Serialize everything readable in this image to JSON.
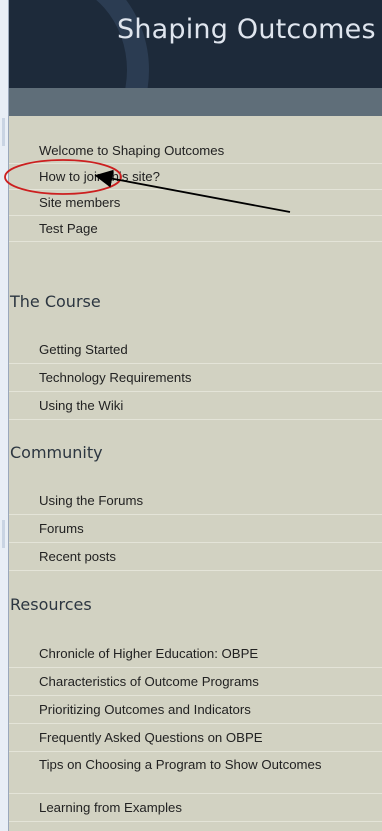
{
  "site": {
    "title": "Shaping Outcomes"
  },
  "nav": {
    "top_items": [
      {
        "label": "Welcome to Shaping Outcomes"
      },
      {
        "label": "How to join this site?"
      },
      {
        "label": "Site members"
      },
      {
        "label": "Test Page"
      }
    ],
    "sections": [
      {
        "heading": "The Course",
        "items": [
          {
            "label": "Getting Started"
          },
          {
            "label": "Technology Requirements"
          },
          {
            "label": "Using the Wiki"
          }
        ]
      },
      {
        "heading": "Community",
        "items": [
          {
            "label": "Using the Forums"
          },
          {
            "label": "Forums"
          },
          {
            "label": "Recent posts"
          }
        ]
      },
      {
        "heading": "Resources",
        "items": [
          {
            "label": "Chronicle of Higher Education: OBPE"
          },
          {
            "label": "Characteristics of Outcome Programs"
          },
          {
            "label": "Prioritizing Outcomes and Indicators"
          },
          {
            "label": "Frequently Asked Questions on OBPE"
          },
          {
            "label": "Tips on Choosing a Program to Show Outcomes"
          },
          {
            "label": "Learning from Examples"
          }
        ]
      }
    ]
  },
  "colors": {
    "header_bg": "#1d2a3a",
    "bar_bg": "#5f6e79",
    "sidebar_bg": "#d2d2c2",
    "annotation_circle": "#cc1f1f",
    "annotation_arrow": "#000000"
  }
}
